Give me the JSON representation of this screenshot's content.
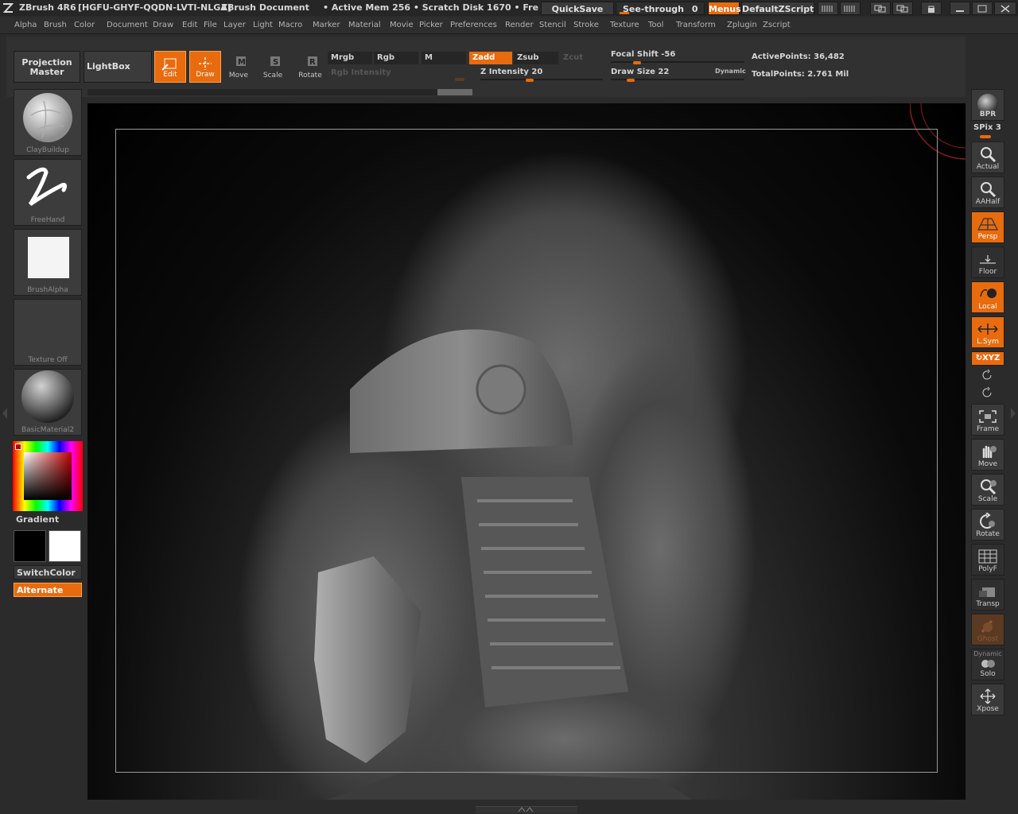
{
  "titlebar": {
    "app": "ZBrush 4R6",
    "serial": "[HGFU-GHYF-QQDN-LVTI-NLGA]",
    "document": "ZBrush Document",
    "status": "• Active Mem 256 • Scratch Disk 1670 • Fre",
    "quicksave": "QuickSave",
    "seethrough_label": "See-through",
    "seethrough_value": "0",
    "menus": "Menus",
    "script": "DefaultZScript"
  },
  "menubar": [
    "Alpha",
    "Brush",
    "Color",
    "Document",
    "Draw",
    "Edit",
    "File",
    "Layer",
    "Light",
    "Macro",
    "Marker",
    "Material",
    "Movie",
    "Picker",
    "Preferences",
    "Render",
    "Stencil",
    "Stroke",
    "Texture",
    "Tool",
    "Transform",
    "Zplugin",
    "Zscript"
  ],
  "shelf": {
    "projection_master": "Projection Master",
    "lightbox": "LightBox",
    "tools": [
      {
        "label": "Edit",
        "on": true,
        "icon": "edit-icon"
      },
      {
        "label": "Draw",
        "on": true,
        "icon": "draw-icon"
      },
      {
        "label": "Move",
        "on": false,
        "icon": "move-icon"
      },
      {
        "label": "Scale",
        "on": false,
        "icon": "scale-icon"
      },
      {
        "label": "Rotate",
        "on": false,
        "icon": "rotate-icon"
      }
    ],
    "mrgb": "Mrgb",
    "rgb": "Rgb",
    "m": "M",
    "rgb_intensity": "Rgb Intensity",
    "zadd": "Zadd",
    "zsub": "Zsub",
    "zcut": "Zcut",
    "z_intensity_label": "Z Intensity",
    "z_intensity": "20",
    "focal_shift_label": "Focal Shift",
    "focal_shift": "-56",
    "draw_size_label": "Draw Size",
    "draw_size": "22",
    "dynamic": "Dynamic",
    "active_points_label": "ActivePoints:",
    "active_points": "36,482",
    "total_points_label": "TotalPoints:",
    "total_points": "2.761 Mil"
  },
  "leftpanel": {
    "brush": "ClayBuildup",
    "stroke": "FreeHand",
    "alpha": "BrushAlpha",
    "texture": "Texture Off",
    "material": "BasicMaterial2",
    "gradient": "Gradient",
    "switchcolor": "SwitchColor",
    "alternate": "Alternate"
  },
  "rightpanel": {
    "bpr": "BPR",
    "spix_label": "SPix",
    "spix": "3",
    "buttons": [
      {
        "label": "Actual",
        "state": "off",
        "icon": "actual-icon"
      },
      {
        "label": "AAHalf",
        "state": "off",
        "icon": "aahalf-icon"
      },
      {
        "label": "Persp",
        "state": "on",
        "icon": "persp-icon"
      },
      {
        "label": "Floor",
        "state": "off",
        "icon": "floor-icon"
      },
      {
        "label": "Local",
        "state": "on",
        "icon": "local-icon"
      },
      {
        "label": "L.Sym",
        "state": "on",
        "icon": "lsym-icon"
      }
    ],
    "xyz": "XYZ",
    "nav": [
      {
        "label": "Frame",
        "icon": "frame-icon"
      },
      {
        "label": "Move",
        "icon": "move-icon"
      },
      {
        "label": "Scale",
        "icon": "scale-icon"
      },
      {
        "label": "Rotate",
        "icon": "rotate-icon"
      },
      {
        "label": "PolyF",
        "icon": "polyf-icon"
      },
      {
        "label": "Transp",
        "icon": "transp-icon"
      },
      {
        "label": "Ghost",
        "icon": "ghost-icon"
      }
    ],
    "dynamic": "Dynamic",
    "solo": "Solo",
    "xpose": "Xpose"
  },
  "colors": {
    "accent": "#e86b0e",
    "panel": "#3a3a3a",
    "background": "#2b2b2b"
  }
}
